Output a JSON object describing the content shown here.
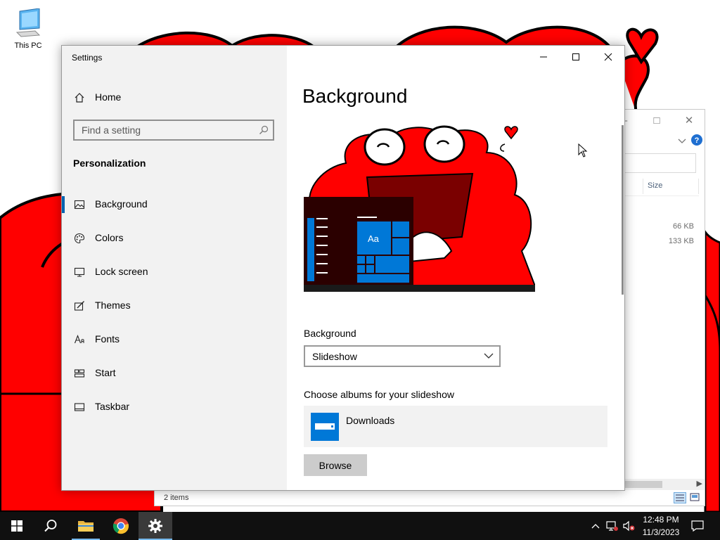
{
  "desktop": {
    "icons": [
      {
        "label": "This PC",
        "icon": "computer-icon"
      }
    ]
  },
  "explorer": {
    "column_header": "Size",
    "rows": [
      {
        "size": "66 KB"
      },
      {
        "size": "133 KB"
      }
    ],
    "status": "2 items"
  },
  "settings": {
    "app_title": "Settings",
    "home_label": "Home",
    "search_placeholder": "Find a setting",
    "section_title": "Personalization",
    "nav": [
      {
        "label": "Background",
        "icon": "picture-icon",
        "active": true
      },
      {
        "label": "Colors",
        "icon": "palette-icon"
      },
      {
        "label": "Lock screen",
        "icon": "lock-screen-icon"
      },
      {
        "label": "Themes",
        "icon": "brush-icon"
      },
      {
        "label": "Fonts",
        "icon": "font-icon"
      },
      {
        "label": "Start",
        "icon": "start-layout-icon"
      },
      {
        "label": "Taskbar",
        "icon": "taskbar-icon"
      }
    ],
    "page_title": "Background",
    "preview_tile_text": "Aa",
    "background_label": "Background",
    "background_value": "Slideshow",
    "albums_label": "Choose albums for your slideshow",
    "album_name": "Downloads",
    "browse_label": "Browse",
    "accent_color": "#0078d7"
  },
  "taskbar": {
    "time": "12:48 PM",
    "date": "11/3/2023"
  },
  "colors": {
    "wallpaper_red": "#ff0000",
    "taskbar": "#101010",
    "sidebar": "#f2f2f2"
  }
}
